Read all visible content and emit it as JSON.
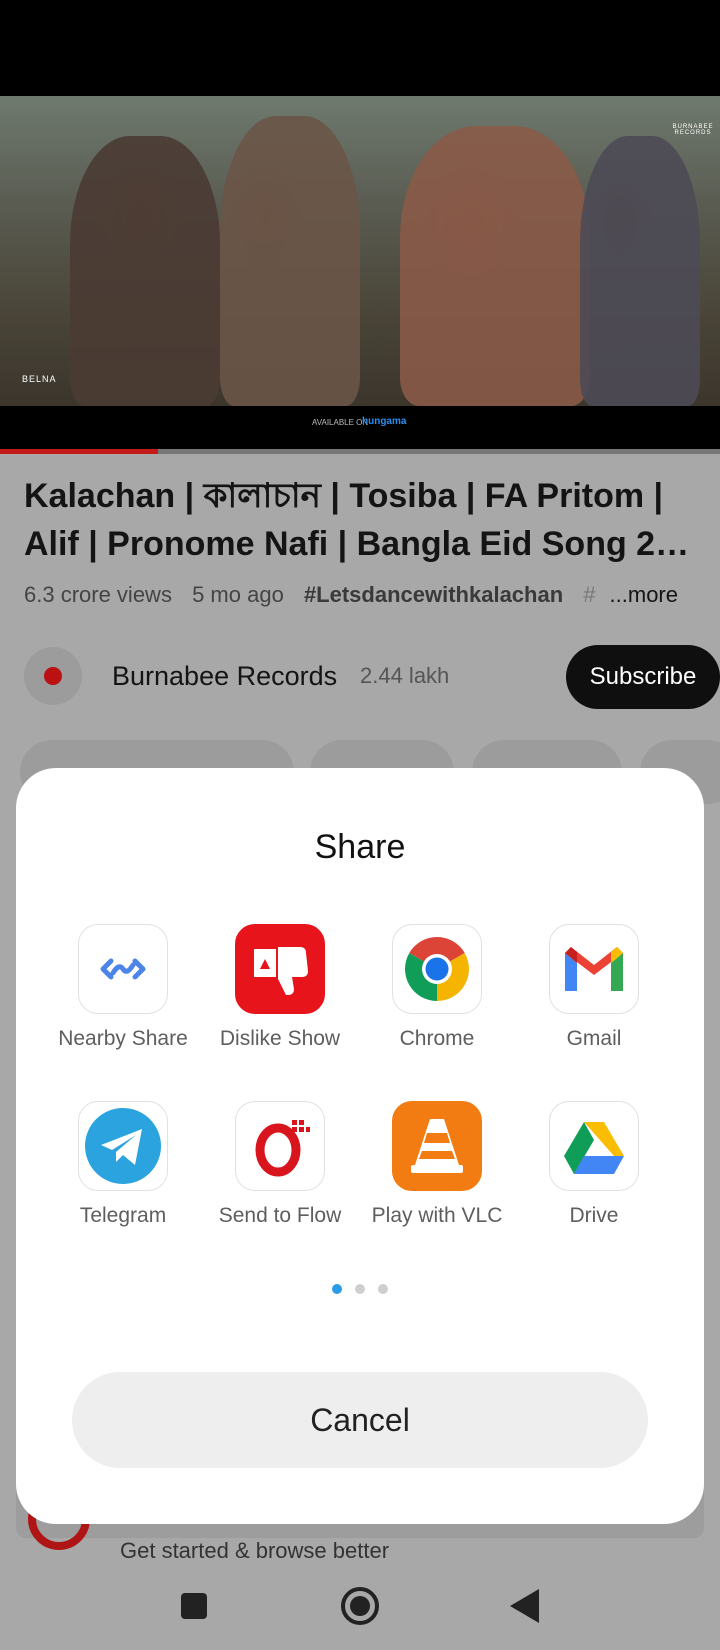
{
  "video": {
    "title": "Kalachan | কালাচান | Tosiba | FA Pritom | Alif | Pronome Nafi | Bangla Eid Song 2…",
    "views": "6.3 crore views",
    "age": "5 mo ago",
    "hashtag": "#Letsdancewithkalachan",
    "hashtag_more": "#",
    "more_label": "...more",
    "progress": 0.22,
    "overlay_available": "AVAILABLE ON",
    "overlay_brand": "hungama",
    "watermark_left": "BELNA",
    "watermark_right": "BURNABEE RECORDS"
  },
  "channel": {
    "name": "Burnabee Records",
    "subscribers": "2.44 lakh",
    "subscribe_label": "Subscribe"
  },
  "promo": {
    "text": "Get started & browse better"
  },
  "share_sheet": {
    "title": "Share",
    "apps": [
      {
        "label": "Nearby Share",
        "icon": "nearby-share-icon"
      },
      {
        "label": "Dislike Show",
        "icon": "dislike-show-icon"
      },
      {
        "label": "Chrome",
        "icon": "chrome-icon"
      },
      {
        "label": "Gmail",
        "icon": "gmail-icon"
      },
      {
        "label": "Telegram",
        "icon": "telegram-icon"
      },
      {
        "label": "Send to Flow",
        "icon": "flow-icon"
      },
      {
        "label": "Play with VLC",
        "icon": "vlc-icon"
      },
      {
        "label": "Drive",
        "icon": "drive-icon"
      }
    ],
    "page_count": 3,
    "current_page": 1,
    "cancel_label": "Cancel"
  },
  "colors": {
    "accent_blue": "#2b9be8",
    "youtube_red": "#c51a1a",
    "subscribe_bg": "#0f0f0f"
  }
}
